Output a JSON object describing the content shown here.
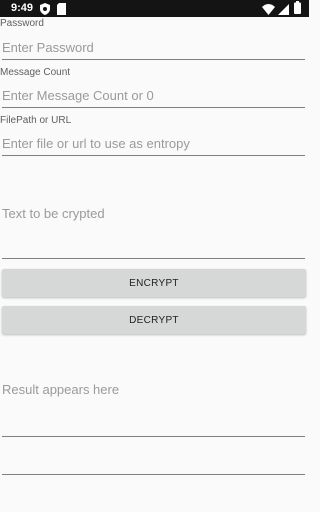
{
  "status_bar": {
    "time": "9:49",
    "icons_left": [
      "shield-icon",
      "sd-card-icon"
    ],
    "icons_right": [
      "wifi-icon",
      "signal-icon",
      "battery-icon"
    ]
  },
  "form": {
    "password": {
      "label": "Password",
      "placeholder": "Enter Password"
    },
    "message_count": {
      "label": "Message Count",
      "placeholder": "Enter Message Count or 0"
    },
    "filepath": {
      "label": "FilePath or URL",
      "placeholder": "Enter file or url to use as entropy"
    },
    "text": {
      "placeholder": "Text to be crypted"
    }
  },
  "buttons": {
    "encrypt": "ENCRYPT",
    "decrypt": "DECRYPT"
  },
  "result": {
    "placeholder": "Result appears here"
  },
  "colors": {
    "status_bar": "#141414",
    "background": "#fafafa",
    "button": "#d6d7d7",
    "underline": "#7f7f7f",
    "hint": "#9a9a9a"
  }
}
